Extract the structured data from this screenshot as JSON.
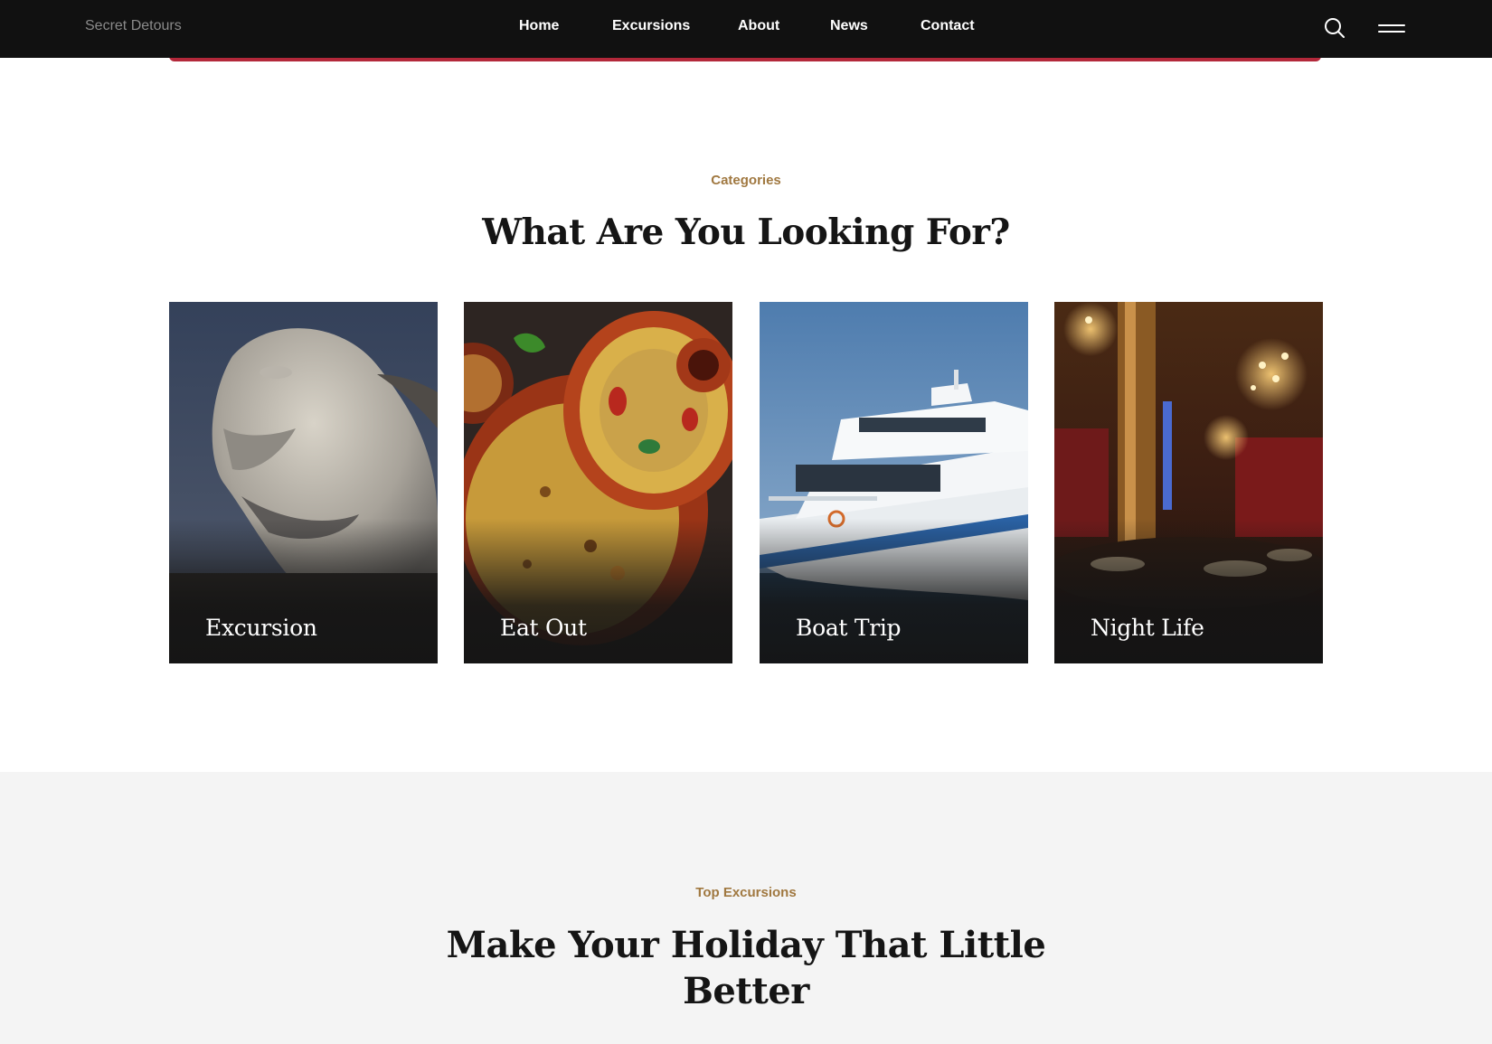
{
  "header": {
    "brand": "Secret Detours",
    "nav": {
      "home": "Home",
      "excursions": "Excursions",
      "about": "About",
      "news": "News",
      "contact": "Contact"
    },
    "icons": {
      "search": "search-icon",
      "menu": "hamburger-menu-icon"
    }
  },
  "categories": {
    "kicker": "Categories",
    "title": "What Are You Looking For?",
    "cards": [
      {
        "label": "Excursion"
      },
      {
        "label": "Eat Out"
      },
      {
        "label": "Boat Trip"
      },
      {
        "label": "Night Life"
      }
    ]
  },
  "top_excursions": {
    "kicker": "Top Excursions",
    "title_line1": "Make Your Holiday That Little",
    "title_line2": "Better"
  },
  "colors": {
    "header_bg": "#111111",
    "accent_red": "#b3283a",
    "kicker_gold": "#a07840",
    "heading_dark": "#151515",
    "band_grey": "#f4f4f4"
  }
}
